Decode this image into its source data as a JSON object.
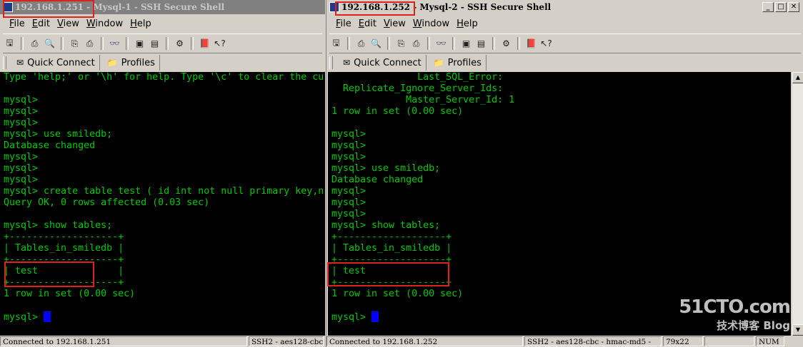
{
  "colors": {
    "terminal_bg": "#000000",
    "terminal_fg": "#00c800",
    "cursor": "#0000ff",
    "highlight_box": "#e0201c"
  },
  "windows": [
    {
      "title_host": "192.168.1.251",
      "title_rest": " - Mysql-1 - SSH Secure Shell",
      "menu": [
        "File",
        "Edit",
        "View",
        "Window",
        "Help"
      ],
      "quick_connect": "Quick Connect",
      "profiles": "Profiles",
      "terminal_lines": [
        "Type 'help;' or '\\h' for help. Type '\\c' to clear the cu",
        "",
        "mysql>",
        "mysql>",
        "mysql>",
        "mysql> use smiledb;",
        "Database changed",
        "mysql>",
        "mysql>",
        "mysql>",
        "mysql> create table test ( id int not null primary key,n",
        "Query OK, 0 rows affected (0.03 sec)",
        "",
        "mysql> show tables;",
        "+-------------------+",
        "| Tables_in_smiledb |",
        "+-------------------+",
        "| test              |",
        "+-------------------+",
        "1 row in set (0.00 sec)",
        "",
        "mysql> "
      ],
      "status": [
        "Connected to 192.168.1.251",
        "SSH2 - aes128-cbc"
      ]
    },
    {
      "title_host": "192.168.1.252",
      "title_rest": " - Mysql-2 - SSH Secure Shell",
      "menu": [
        "File",
        "Edit",
        "View",
        "Window",
        "Help"
      ],
      "quick_connect": "Quick Connect",
      "profiles": "Profiles",
      "terminal_lines": [
        "               Last_SQL_Error:",
        "  Replicate_Ignore_Server_Ids:",
        "             Master_Server_Id: 1",
        "1 row in set (0.00 sec)",
        "",
        "mysql>",
        "mysql>",
        "mysql>",
        "mysql> use smiledb;",
        "Database changed",
        "mysql>",
        "mysql>",
        "mysql>",
        "mysql> show tables;",
        "+-------------------+",
        "| Tables_in_smiledb |",
        "+-------------------+",
        "| test              |",
        "+-------------------+",
        "1 row in set (0.00 sec)",
        "",
        "mysql> "
      ],
      "status": [
        "Connected to 192.168.1.252",
        "SSH2 - aes128-cbc - hmac-md5 - ",
        "79x22",
        "",
        "NUM"
      ]
    }
  ],
  "watermark": {
    "main": "51CTO.com",
    "sub": "技术博客 Blog"
  },
  "toolbar_icons": [
    "save-icon",
    "print-icon",
    "print-preview-icon",
    "copy-icon",
    "paste-icon",
    "find-icon",
    "new-terminal-icon",
    "new-file-transfer-icon",
    "settings-icon",
    "help-book-icon",
    "context-help-icon"
  ]
}
